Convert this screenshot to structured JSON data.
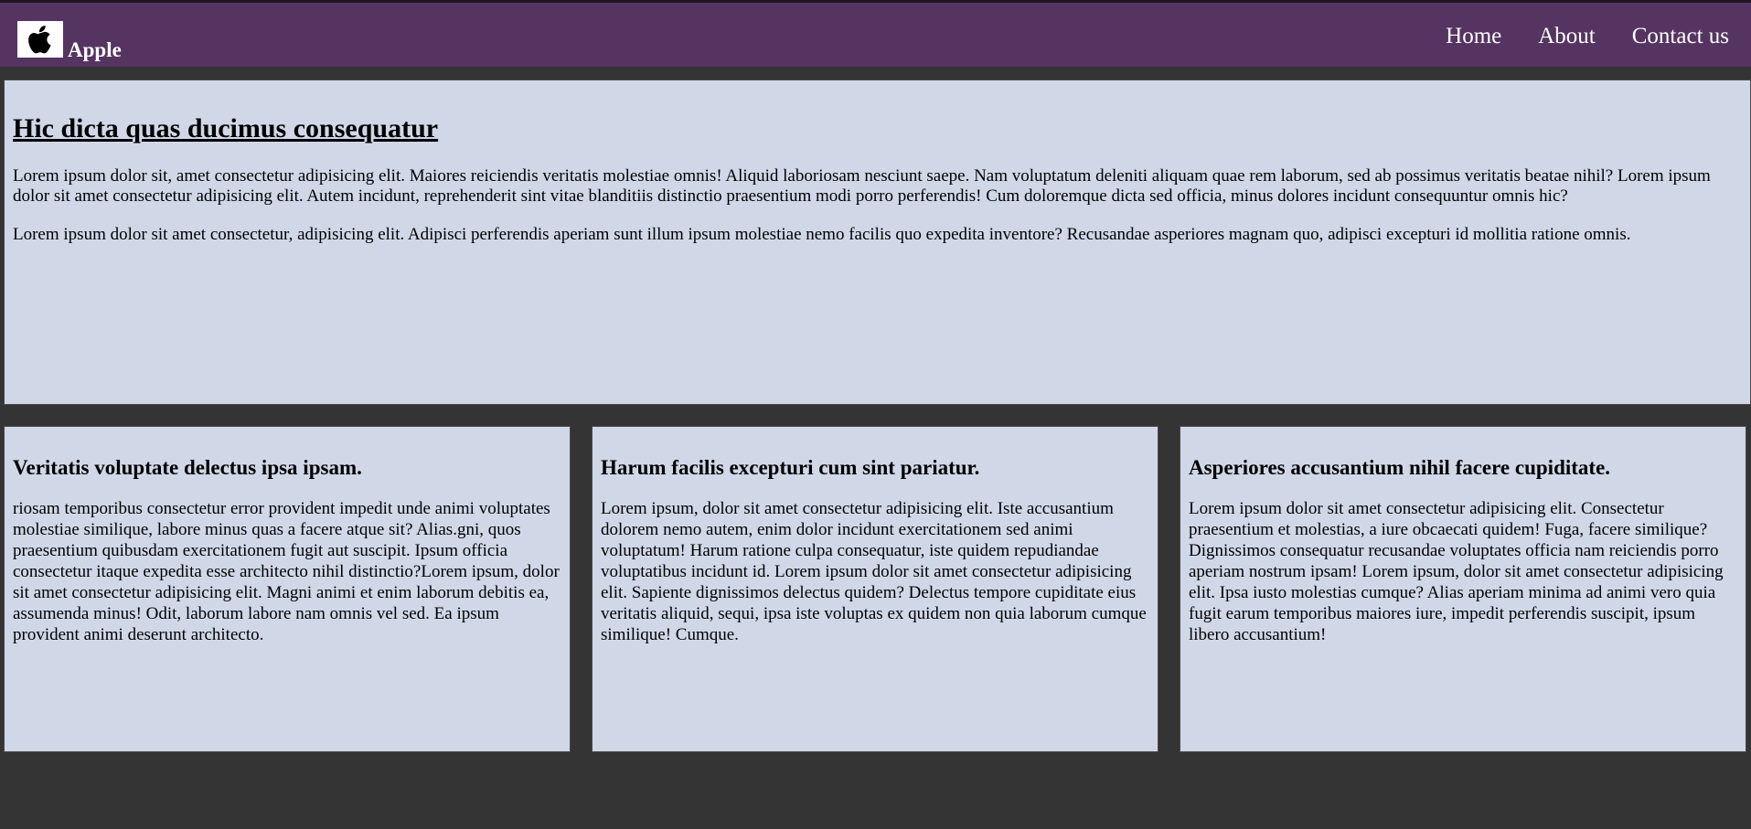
{
  "header": {
    "logo_icon": "apple-logo-icon",
    "brand": "Apple",
    "nav": [
      {
        "label": "Home"
      },
      {
        "label": "About"
      },
      {
        "label": "Contact us"
      }
    ],
    "colors": {
      "bar": "#553461",
      "page_background": "#343434",
      "panel": "#d0d8e8"
    }
  },
  "hero": {
    "title": "Hic dicta quas ducimus consequatur",
    "paragraph1": "Lorem ipsum dolor sit, amet consectetur adipisicing elit. Maiores reiciendis veritatis molestiae omnis! Aliquid laboriosam nesciunt saepe. Nam voluptatum deleniti aliquam quae rem laborum, sed ab possimus veritatis beatae nihil? Lorem ipsum dolor sit amet consectetur adipisicing elit. Autem incidunt, reprehenderit sint vitae blanditiis distinctio praesentium modi porro perferendis! Cum doloremque dicta sed officia, minus dolores incidunt consequuntur omnis hic?",
    "paragraph2": "Lorem ipsum dolor sit amet consectetur, adipisicing elit. Adipisci perferendis aperiam sunt illum ipsum molestiae nemo facilis quo expedita inventore? Recusandae asperiores magnam quo, adipisci excepturi id mollitia ratione omnis."
  },
  "cards": [
    {
      "title": "Veritatis voluptate delectus ipsa ipsam.",
      "body": "riosam temporibus consectetur error provident impedit unde animi voluptates molestiae similique, labore minus quas a facere atque sit? Alias.gni, quos praesentium quibusdam exercitationem fugit aut suscipit. Ipsum officia consectetur itaque expedita esse architecto nihil distinctio?Lorem ipsum, dolor sit amet consectetur adipisicing elit. Magni animi et enim laborum debitis ea, assumenda minus! Odit, laborum labore nam omnis vel sed. Ea ipsum provident animi deserunt architecto."
    },
    {
      "title": "Harum facilis excepturi cum sint pariatur.",
      "body": "Lorem ipsum, dolor sit amet consectetur adipisicing elit. Iste accusantium dolorem nemo autem, enim dolor incidunt exercitationem sed animi voluptatum! Harum ratione culpa consequatur, iste quidem repudiandae voluptatibus incidunt id. Lorem ipsum dolor sit amet consectetur adipisicing elit. Sapiente dignissimos delectus quidem? Delectus tempore cupiditate eius veritatis aliquid, sequi, ipsa iste voluptas ex quidem non quia laborum cumque similique! Cumque."
    },
    {
      "title": "Asperiores accusantium nihil facere cupiditate.",
      "body": "Lorem ipsum dolor sit amet consectetur adipisicing elit. Consectetur praesentium et molestias, a iure obcaecati quidem! Fuga, facere similique? Dignissimos consequatur recusandae voluptates officia nam reiciendis porro aperiam nostrum ipsam! Lorem ipsum, dolor sit amet consectetur adipisicing elit. Ipsa iusto molestias cumque? Alias aperiam minima ad animi vero quia fugit earum temporibus maiores iure, impedit perferendis suscipit, ipsum libero accusantium!"
    }
  ]
}
